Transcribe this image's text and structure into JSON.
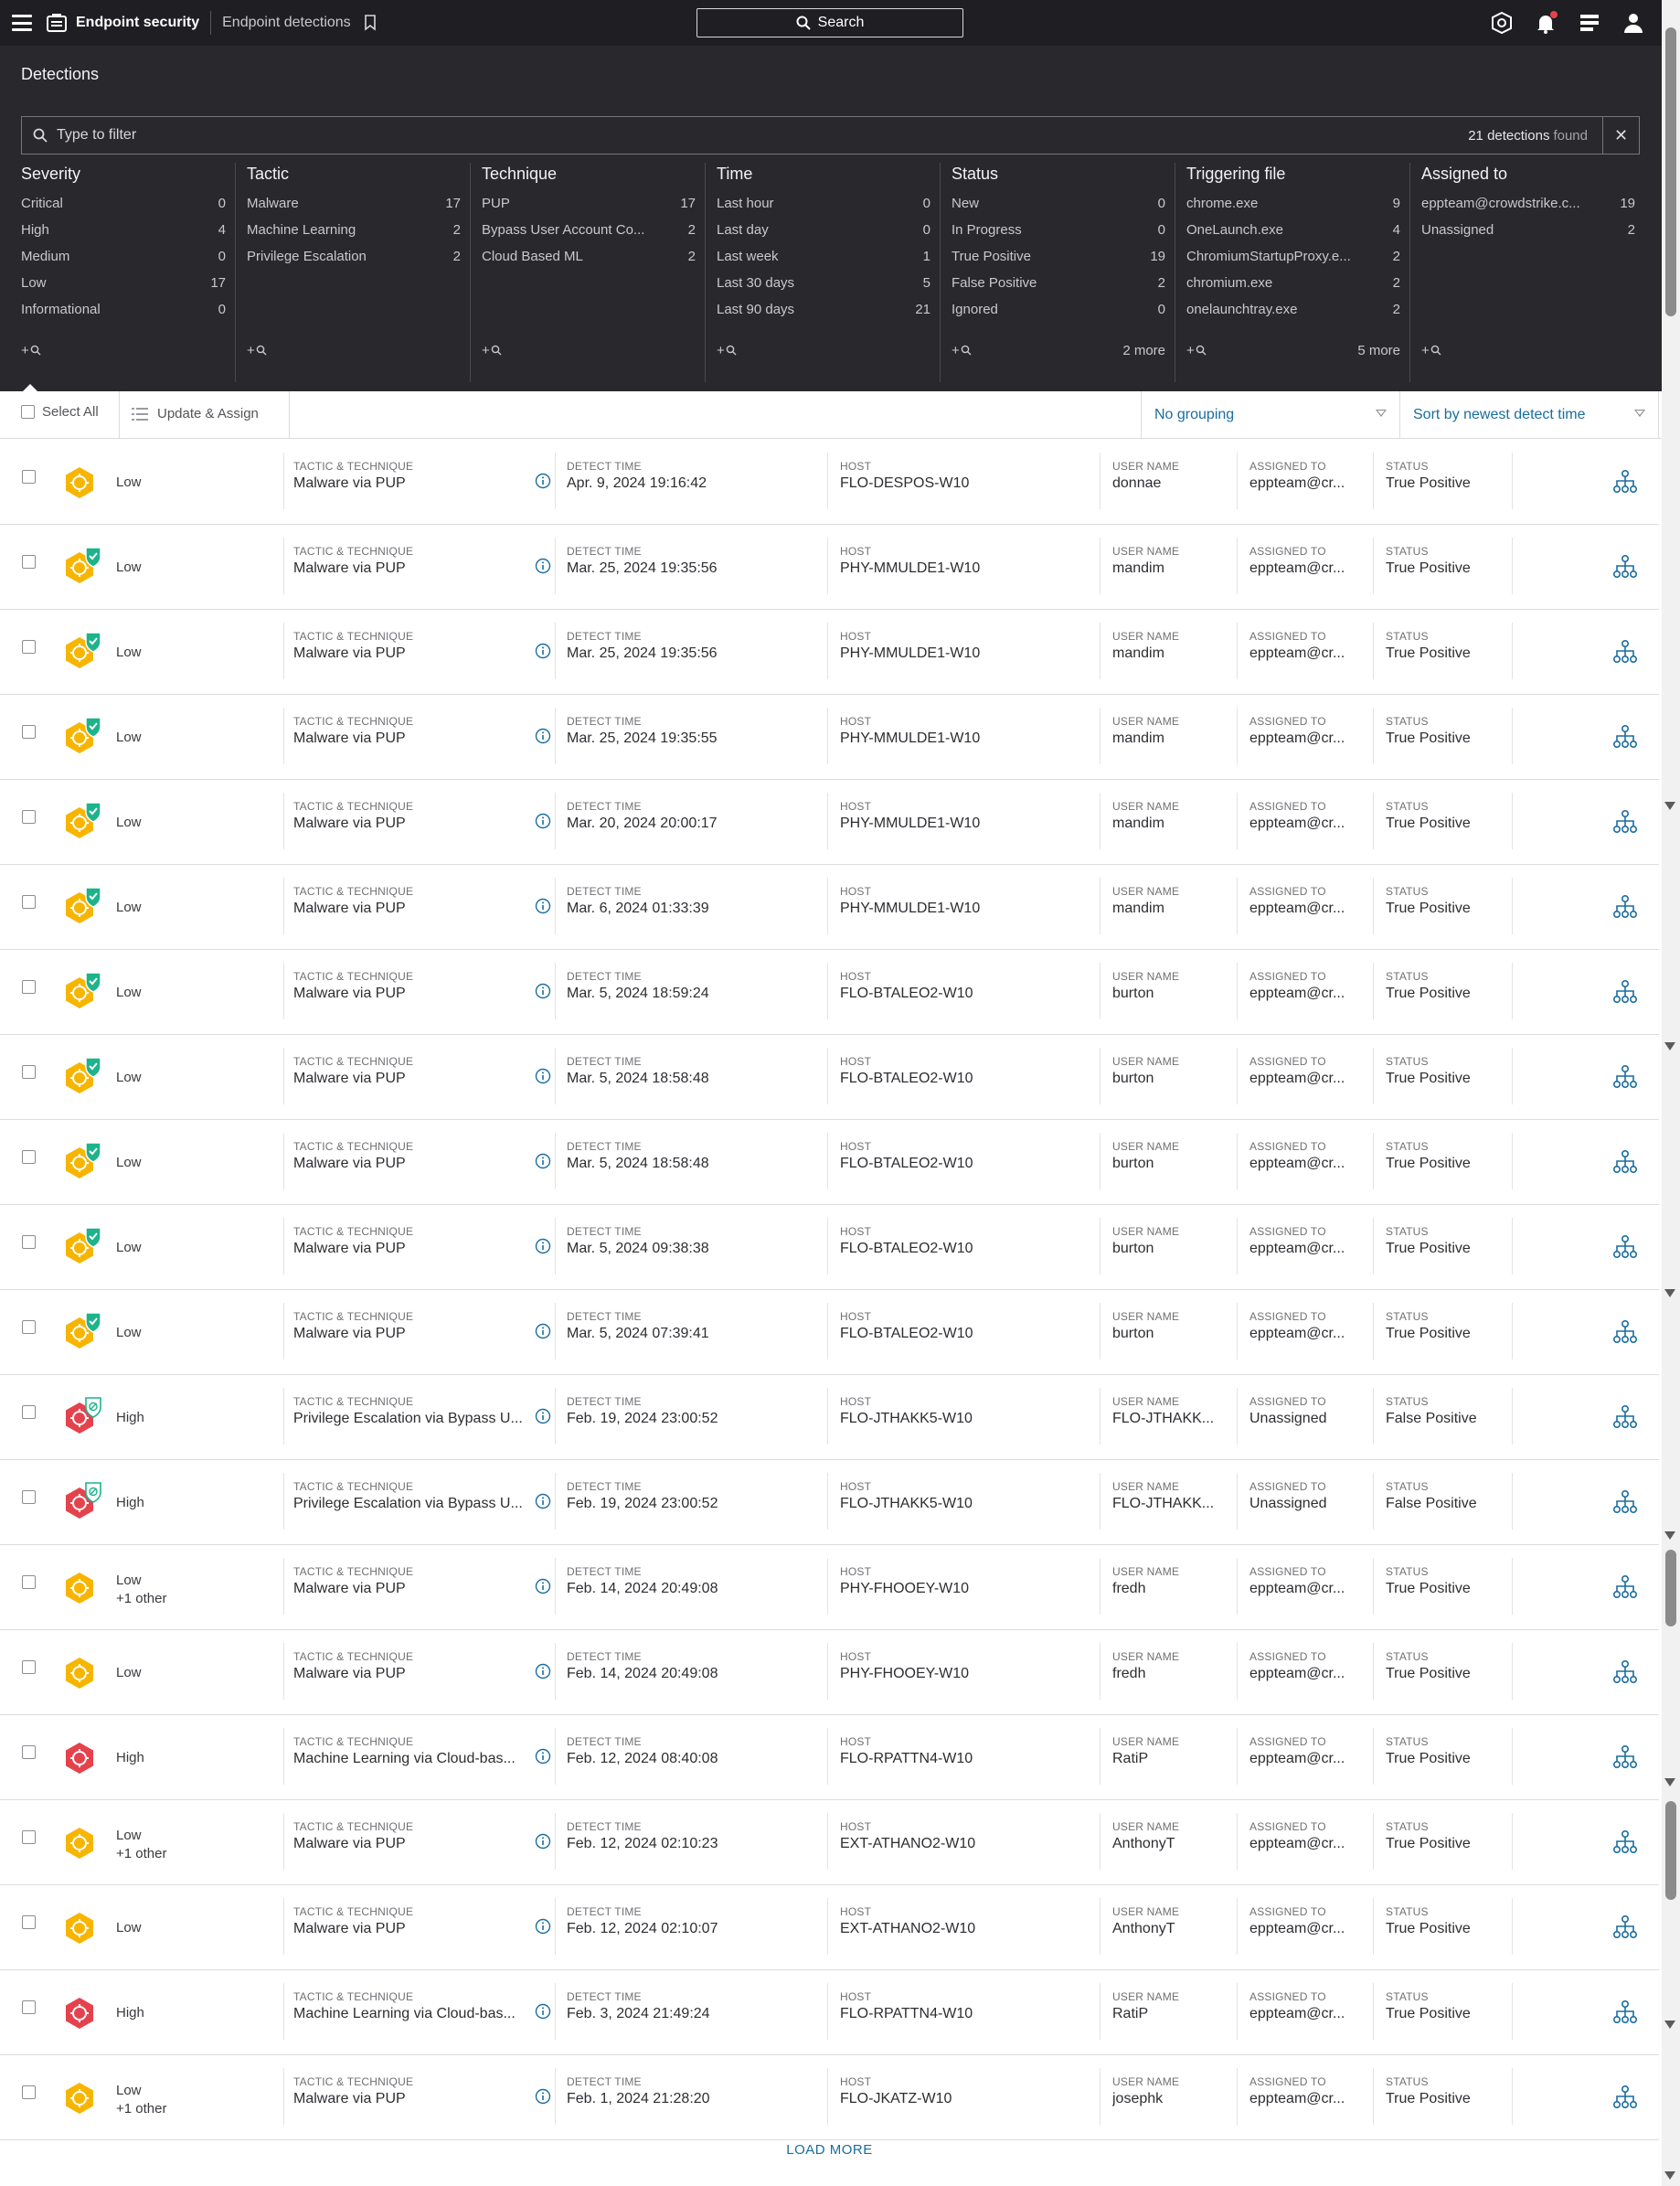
{
  "topbar": {
    "app_title": "Endpoint security",
    "page": "Endpoint detections",
    "search_label": "Search"
  },
  "panel": {
    "title": "Detections",
    "filter_placeholder": "Type to filter",
    "found_count": "21 detections",
    "found_word": "found"
  },
  "facets": [
    {
      "title": "Severity",
      "items": [
        [
          "Critical",
          "0"
        ],
        [
          "High",
          "4"
        ],
        [
          "Medium",
          "0"
        ],
        [
          "Low",
          "17"
        ],
        [
          "Informational",
          "0"
        ]
      ],
      "more": ""
    },
    {
      "title": "Tactic",
      "items": [
        [
          "Malware",
          "17"
        ],
        [
          "Machine Learning",
          "2"
        ],
        [
          "Privilege Escalation",
          "2"
        ]
      ],
      "more": ""
    },
    {
      "title": "Technique",
      "items": [
        [
          "PUP",
          "17"
        ],
        [
          "Bypass User Account Co...",
          "2"
        ],
        [
          "Cloud Based ML",
          "2"
        ]
      ],
      "more": ""
    },
    {
      "title": "Time",
      "items": [
        [
          "Last hour",
          "0"
        ],
        [
          "Last day",
          "0"
        ],
        [
          "Last week",
          "1"
        ],
        [
          "Last 30 days",
          "5"
        ],
        [
          "Last 90 days",
          "21"
        ]
      ],
      "more": ""
    },
    {
      "title": "Status",
      "items": [
        [
          "New",
          "0"
        ],
        [
          "In Progress",
          "0"
        ],
        [
          "True Positive",
          "19"
        ],
        [
          "False Positive",
          "2"
        ],
        [
          "Ignored",
          "0"
        ]
      ],
      "more": "2 more"
    },
    {
      "title": "Triggering file",
      "items": [
        [
          "chrome.exe",
          "9"
        ],
        [
          "OneLaunch.exe",
          "4"
        ],
        [
          "ChromiumStartupProxy.e...",
          "2"
        ],
        [
          "chromium.exe",
          "2"
        ],
        [
          "onelaunchtray.exe",
          "2"
        ]
      ],
      "more": "5 more"
    },
    {
      "title": "Assigned to",
      "items": [
        [
          "eppteam@crowdstrike.c...",
          "19"
        ],
        [
          "Unassigned",
          "2"
        ]
      ],
      "more": ""
    }
  ],
  "facet_add_label": "+",
  "toolbar": {
    "select_all": "Select All",
    "update_assign": "Update & Assign",
    "grouping": "No grouping",
    "sort": "Sort by newest detect time"
  },
  "captions": {
    "tactic": "TACTIC & TECHNIQUE",
    "time": "DETECT TIME",
    "host": "HOST",
    "user": "USER NAME",
    "assigned": "ASSIGNED TO",
    "status": "STATUS"
  },
  "colors": {
    "low": "#f7b500",
    "high": "#e5424d",
    "shield_green": "#1db38b",
    "link": "#1a6d9e"
  },
  "rows": [
    {
      "severity": "Low",
      "other": "",
      "badge": "none",
      "tactic": "Malware via PUP",
      "time": "Apr. 9, 2024 19:16:42",
      "host": "FLO-DESPOS-W10",
      "user": "donnae",
      "assigned": "eppteam@cr...",
      "status": "True Positive"
    },
    {
      "severity": "Low",
      "other": "",
      "badge": "check",
      "tactic": "Malware via PUP",
      "time": "Mar. 25, 2024 19:35:56",
      "host": "PHY-MMULDE1-W10",
      "user": "mandim",
      "assigned": "eppteam@cr...",
      "status": "True Positive"
    },
    {
      "severity": "Low",
      "other": "",
      "badge": "check",
      "tactic": "Malware via PUP",
      "time": "Mar. 25, 2024 19:35:56",
      "host": "PHY-MMULDE1-W10",
      "user": "mandim",
      "assigned": "eppteam@cr...",
      "status": "True Positive"
    },
    {
      "severity": "Low",
      "other": "",
      "badge": "check",
      "tactic": "Malware via PUP",
      "time": "Mar. 25, 2024 19:35:55",
      "host": "PHY-MMULDE1-W10",
      "user": "mandim",
      "assigned": "eppteam@cr...",
      "status": "True Positive"
    },
    {
      "severity": "Low",
      "other": "",
      "badge": "check",
      "tactic": "Malware via PUP",
      "time": "Mar. 20, 2024 20:00:17",
      "host": "PHY-MMULDE1-W10",
      "user": "mandim",
      "assigned": "eppteam@cr...",
      "status": "True Positive"
    },
    {
      "severity": "Low",
      "other": "",
      "badge": "check",
      "tactic": "Malware via PUP",
      "time": "Mar. 6, 2024 01:33:39",
      "host": "PHY-MMULDE1-W10",
      "user": "mandim",
      "assigned": "eppteam@cr...",
      "status": "True Positive"
    },
    {
      "severity": "Low",
      "other": "",
      "badge": "check",
      "tactic": "Malware via PUP",
      "time": "Mar. 5, 2024 18:59:24",
      "host": "FLO-BTALEO2-W10",
      "user": "burton",
      "assigned": "eppteam@cr...",
      "status": "True Positive"
    },
    {
      "severity": "Low",
      "other": "",
      "badge": "check",
      "tactic": "Malware via PUP",
      "time": "Mar. 5, 2024 18:58:48",
      "host": "FLO-BTALEO2-W10",
      "user": "burton",
      "assigned": "eppteam@cr...",
      "status": "True Positive"
    },
    {
      "severity": "Low",
      "other": "",
      "badge": "check",
      "tactic": "Malware via PUP",
      "time": "Mar. 5, 2024 18:58:48",
      "host": "FLO-BTALEO2-W10",
      "user": "burton",
      "assigned": "eppteam@cr...",
      "status": "True Positive"
    },
    {
      "severity": "Low",
      "other": "",
      "badge": "check",
      "tactic": "Malware via PUP",
      "time": "Mar. 5, 2024 09:38:38",
      "host": "FLO-BTALEO2-W10",
      "user": "burton",
      "assigned": "eppteam@cr...",
      "status": "True Positive"
    },
    {
      "severity": "Low",
      "other": "",
      "badge": "check",
      "tactic": "Malware via PUP",
      "time": "Mar. 5, 2024 07:39:41",
      "host": "FLO-BTALEO2-W10",
      "user": "burton",
      "assigned": "eppteam@cr...",
      "status": "True Positive"
    },
    {
      "severity": "High",
      "other": "",
      "badge": "slash",
      "tactic": "Privilege Escalation via Bypass U...",
      "time": "Feb. 19, 2024 23:00:52",
      "host": "FLO-JTHAKK5-W10",
      "user": "FLO-JTHAKK...",
      "assigned": "Unassigned",
      "status": "False Positive"
    },
    {
      "severity": "High",
      "other": "",
      "badge": "slash",
      "tactic": "Privilege Escalation via Bypass U...",
      "time": "Feb. 19, 2024 23:00:52",
      "host": "FLO-JTHAKK5-W10",
      "user": "FLO-JTHAKK...",
      "assigned": "Unassigned",
      "status": "False Positive"
    },
    {
      "severity": "Low",
      "other": "+1 other",
      "badge": "none",
      "tactic": "Malware via PUP",
      "time": "Feb. 14, 2024 20:49:08",
      "host": "PHY-FHOOEY-W10",
      "user": "fredh",
      "assigned": "eppteam@cr...",
      "status": "True Positive"
    },
    {
      "severity": "Low",
      "other": "",
      "badge": "none",
      "tactic": "Malware via PUP",
      "time": "Feb. 14, 2024 20:49:08",
      "host": "PHY-FHOOEY-W10",
      "user": "fredh",
      "assigned": "eppteam@cr...",
      "status": "True Positive"
    },
    {
      "severity": "High",
      "other": "",
      "badge": "none",
      "tactic": "Machine Learning via Cloud-bas...",
      "time": "Feb. 12, 2024 08:40:08",
      "host": "FLO-RPATTN4-W10",
      "user": "RatiP",
      "assigned": "eppteam@cr...",
      "status": "True Positive"
    },
    {
      "severity": "Low",
      "other": "+1 other",
      "badge": "none",
      "tactic": "Malware via PUP",
      "time": "Feb. 12, 2024 02:10:23",
      "host": "EXT-ATHANO2-W10",
      "user": "AnthonyT",
      "assigned": "eppteam@cr...",
      "status": "True Positive"
    },
    {
      "severity": "Low",
      "other": "",
      "badge": "none",
      "tactic": "Malware via PUP",
      "time": "Feb. 12, 2024 02:10:07",
      "host": "EXT-ATHANO2-W10",
      "user": "AnthonyT",
      "assigned": "eppteam@cr...",
      "status": "True Positive"
    },
    {
      "severity": "High",
      "other": "",
      "badge": "none",
      "tactic": "Machine Learning via Cloud-bas...",
      "time": "Feb. 3, 2024 21:49:24",
      "host": "FLO-RPATTN4-W10",
      "user": "RatiP",
      "assigned": "eppteam@cr...",
      "status": "True Positive"
    },
    {
      "severity": "Low",
      "other": "+1 other",
      "badge": "none",
      "tactic": "Malware via PUP",
      "time": "Feb. 1, 2024 21:28:20",
      "host": "FLO-JKATZ-W10",
      "user": "josephk",
      "assigned": "eppteam@cr...",
      "status": "True Positive"
    }
  ],
  "load_more": "LOAD MORE"
}
